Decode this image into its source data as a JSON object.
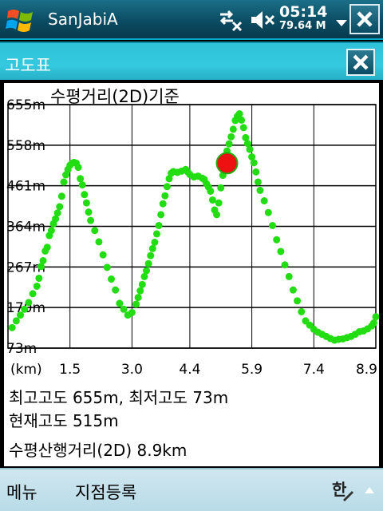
{
  "statusbar": {
    "app_title": "SanJabiA",
    "clock": "05:14",
    "memory": "79.64 M",
    "icons": [
      "windows-start-icon",
      "network-icon",
      "volume-muted-icon",
      "close-icon"
    ]
  },
  "dialog": {
    "title": "고도표",
    "close_icon": "close-icon"
  },
  "chart_data": {
    "type": "scatter",
    "title": "수평거리(2D)기준",
    "xlabel": "(km)",
    "x_tick_labels": [
      "1.5",
      "3.0",
      "4.4",
      "5.9",
      "7.4",
      "8.9"
    ],
    "x_ticks": [
      1.5,
      3.0,
      4.4,
      5.9,
      7.4,
      8.9
    ],
    "y_tick_labels": [
      "655m",
      "558m",
      "461m",
      "364m",
      "267m",
      "170m",
      "73m"
    ],
    "y_ticks": [
      655,
      558,
      461,
      364,
      267,
      170,
      73
    ],
    "xlim": [
      0,
      8.9
    ],
    "ylim": [
      73,
      655
    ],
    "grid": true,
    "series": [
      {
        "color": "#22dd11",
        "points": [
          [
            0.1,
            122
          ],
          [
            0.2,
            138
          ],
          [
            0.3,
            152
          ],
          [
            0.4,
            166
          ],
          [
            0.5,
            182
          ],
          [
            0.6,
            203
          ],
          [
            0.7,
            221
          ],
          [
            0.75,
            240
          ],
          [
            0.8,
            268
          ],
          [
            0.85,
            282
          ],
          [
            0.9,
            305
          ],
          [
            0.95,
            314
          ],
          [
            1.0,
            342
          ],
          [
            1.05,
            354
          ],
          [
            1.1,
            370
          ],
          [
            1.15,
            382
          ],
          [
            1.2,
            396
          ],
          [
            1.25,
            411
          ],
          [
            1.3,
            436
          ],
          [
            1.35,
            470
          ],
          [
            1.4,
            487
          ],
          [
            1.45,
            500
          ],
          [
            1.5,
            510
          ],
          [
            1.55,
            515
          ],
          [
            1.6,
            517
          ],
          [
            1.65,
            515
          ],
          [
            1.7,
            505
          ],
          [
            1.75,
            478
          ],
          [
            1.8,
            463
          ],
          [
            1.85,
            440
          ],
          [
            1.9,
            420
          ],
          [
            1.95,
            398
          ],
          [
            2.0,
            378
          ],
          [
            2.1,
            354
          ],
          [
            2.2,
            327
          ],
          [
            2.3,
            296
          ],
          [
            2.4,
            266
          ],
          [
            2.5,
            238
          ],
          [
            2.6,
            212
          ],
          [
            2.7,
            180
          ],
          [
            2.8,
            166
          ],
          [
            2.9,
            152
          ],
          [
            3.0,
            158
          ],
          [
            3.1,
            178
          ],
          [
            3.15,
            194
          ],
          [
            3.2,
            210
          ],
          [
            3.25,
            225
          ],
          [
            3.3,
            244
          ],
          [
            3.35,
            258
          ],
          [
            3.4,
            275
          ],
          [
            3.45,
            294
          ],
          [
            3.5,
            311
          ],
          [
            3.55,
            326
          ],
          [
            3.6,
            346
          ],
          [
            3.65,
            366
          ],
          [
            3.7,
            392
          ],
          [
            3.75,
            418
          ],
          [
            3.8,
            437
          ],
          [
            3.85,
            459
          ],
          [
            3.9,
            478
          ],
          [
            3.95,
            491
          ],
          [
            4.0,
            495
          ],
          [
            4.1,
            493
          ],
          [
            4.2,
            496
          ],
          [
            4.3,
            500
          ],
          [
            4.35,
            494
          ],
          [
            4.4,
            488
          ],
          [
            4.5,
            482
          ],
          [
            4.6,
            484
          ],
          [
            4.7,
            479
          ],
          [
            4.75,
            476
          ],
          [
            4.8,
            466
          ],
          [
            4.85,
            458
          ],
          [
            4.9,
            448
          ],
          [
            4.95,
            427
          ],
          [
            5.0,
            403
          ],
          [
            5.05,
            392
          ],
          [
            5.1,
            420
          ],
          [
            5.15,
            456
          ],
          [
            5.2,
            486
          ],
          [
            5.25,
            518
          ],
          [
            5.3,
            544
          ],
          [
            5.35,
            561
          ],
          [
            5.4,
            578
          ],
          [
            5.45,
            596
          ],
          [
            5.5,
            617
          ],
          [
            5.55,
            627
          ],
          [
            5.6,
            633
          ],
          [
            5.65,
            618
          ],
          [
            5.7,
            600
          ],
          [
            5.75,
            576
          ],
          [
            5.8,
            562
          ],
          [
            5.85,
            548
          ],
          [
            5.9,
            530
          ],
          [
            5.95,
            516
          ],
          [
            6.0,
            494
          ],
          [
            6.05,
            470
          ],
          [
            6.1,
            450
          ],
          [
            6.2,
            425
          ],
          [
            6.3,
            397
          ],
          [
            6.4,
            366
          ],
          [
            6.5,
            332
          ],
          [
            6.6,
            304
          ],
          [
            6.7,
            272
          ],
          [
            6.8,
            244
          ],
          [
            6.9,
            212
          ],
          [
            7.0,
            186
          ],
          [
            7.1,
            160
          ],
          [
            7.2,
            138
          ],
          [
            7.3,
            128
          ],
          [
            7.4,
            118
          ],
          [
            7.5,
            111
          ],
          [
            7.6,
            106
          ],
          [
            7.7,
            101
          ],
          [
            7.8,
            96
          ],
          [
            7.9,
            92
          ],
          [
            8.0,
            94
          ],
          [
            8.1,
            95
          ],
          [
            8.2,
            98
          ],
          [
            8.3,
            101
          ],
          [
            8.4,
            106
          ],
          [
            8.5,
            112
          ],
          [
            8.6,
            114
          ],
          [
            8.7,
            119
          ],
          [
            8.8,
            126
          ],
          [
            8.85,
            133
          ],
          [
            8.9,
            148
          ]
        ]
      }
    ],
    "current_point": {
      "x": 5.3,
      "y": 515,
      "color": "#ee1111"
    }
  },
  "info": {
    "max_min": "최고고도 655m, 최저고도 73m",
    "current": "현재고도 515m",
    "distance": "수평산행거리(2D)  8.9km"
  },
  "softkeys": {
    "left": "메뉴",
    "right": "지점등록",
    "ime_icon": "keyboard-input-icon"
  }
}
